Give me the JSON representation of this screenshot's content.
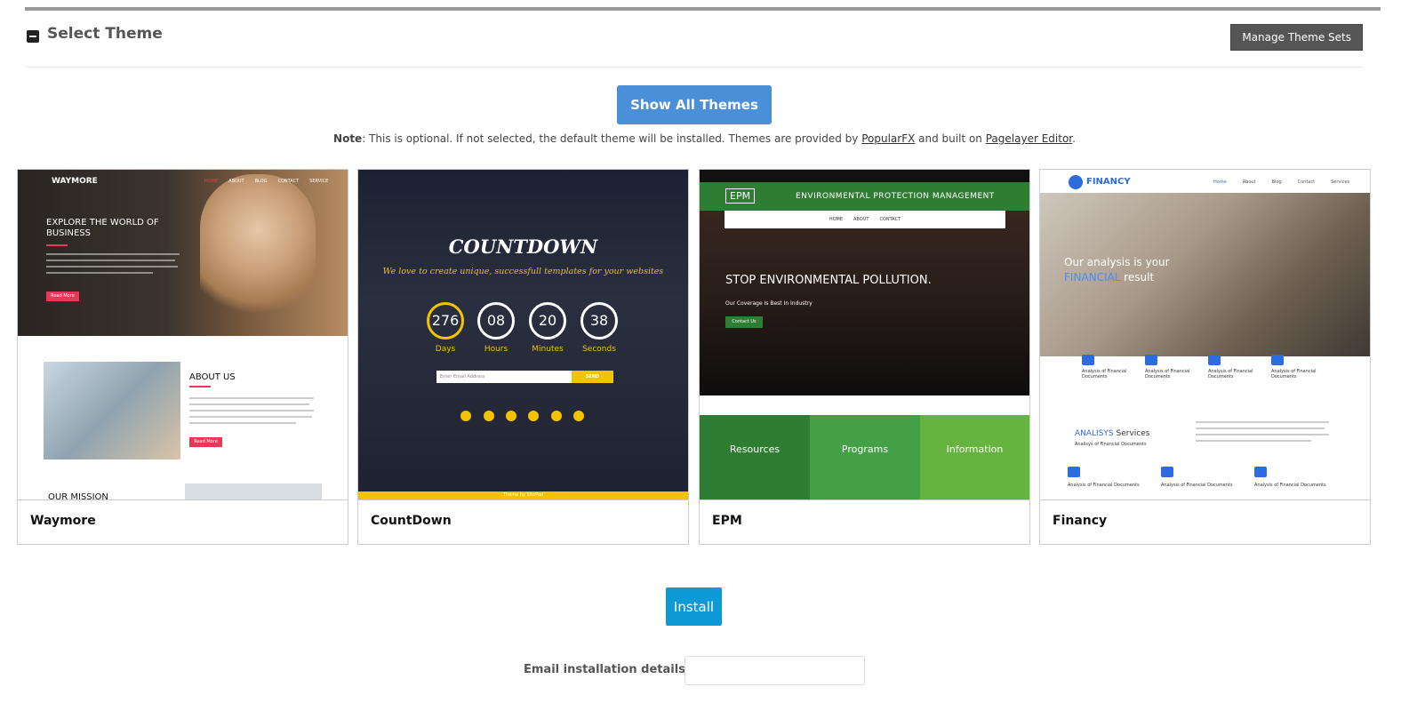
{
  "header": {
    "title": "Select Theme",
    "manage_label": "Manage Theme Sets"
  },
  "show_all_label": "Show All Themes",
  "note": {
    "bold": "Note",
    "text1": ": This is optional. If not selected, the default theme will be installed. Themes are provided by ",
    "link1": "PopularFX",
    "text2": " and built on ",
    "link2": "Pagelayer Editor",
    "text3": "."
  },
  "themes": [
    {
      "name": "Waymore",
      "preview": {
        "brand": "WAYMORE",
        "nav": [
          "HOME",
          "ABOUT",
          "BLOG",
          "CONTACT",
          "SERVICE"
        ],
        "headline": "EXPLORE THE WORLD OF BUSINESS",
        "button": "Read More",
        "about": "ABOUT US",
        "mission": "OUR MISSION"
      }
    },
    {
      "name": "CountDown",
      "preview": {
        "title": "COUNTDOWN",
        "tagline": "We love to create unique, successfull templates for your websites",
        "counters": [
          {
            "value": "276",
            "label": "Days"
          },
          {
            "value": "08",
            "label": "Hours"
          },
          {
            "value": "20",
            "label": "Minutes"
          },
          {
            "value": "38",
            "label": "Seconds"
          }
        ],
        "email_placeholder": "Enter Email Address",
        "send": "SEND",
        "footer": "Theme by SitePad"
      }
    },
    {
      "name": "EPM",
      "preview": {
        "logo": "EPM",
        "heading": "ENVIRONMENTAL PROTECTION MANAGEMENT",
        "nav": [
          "HOME",
          "ABOUT",
          "CONTACT"
        ],
        "headline": "STOP ENVIRONMENTAL POLLUTION.",
        "sub": "Our Coverage Is Best In Industry",
        "button": "Contact Us",
        "columns": [
          "Resources",
          "Programs",
          "Information"
        ]
      }
    },
    {
      "name": "Financy",
      "preview": {
        "brand": "FINANCY",
        "nav": [
          "Home",
          "About",
          "Blog",
          "Contact",
          "Services"
        ],
        "headline1": "Our analysis is your",
        "headline2": "FINANCIAL",
        "headline3": " result",
        "item": "Analysis of Financial Documents",
        "services_a": "ANALISYS",
        "services_b": " Services",
        "services_sub": "Analisys of Financial Documents"
      }
    }
  ],
  "install_label": "Install",
  "email_label": "Email installation details to :",
  "email_value": "",
  "colors": {
    "primary_blue": "#4a90d9",
    "install_blue": "#0e9ad6",
    "manage_grey": "#555555",
    "countdown_yellow": "#f2c300",
    "epm_green": "#2e7d32"
  }
}
